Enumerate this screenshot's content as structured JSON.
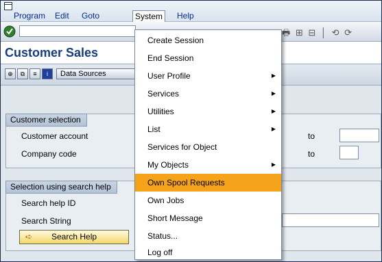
{
  "menubar": {
    "items": [
      "Program",
      "Edit",
      "Goto",
      "System",
      "Help"
    ]
  },
  "title": "Customer Sales",
  "apptoolbar": {
    "data_sources_label": "Data Sources"
  },
  "groups": {
    "customer_selection": {
      "title": "Customer selection",
      "rows": [
        "Customer account",
        "Company code"
      ],
      "to_label": "to"
    },
    "search_help": {
      "title": "Selection using search help",
      "rows": [
        "Search help ID",
        "Search String"
      ],
      "button": "Search Help"
    }
  },
  "system_menu": {
    "items": [
      {
        "label": "Create Session",
        "submenu": false
      },
      {
        "label": "End Session",
        "submenu": false
      },
      {
        "label": "User Profile",
        "submenu": true
      },
      {
        "label": "Services",
        "submenu": true
      },
      {
        "label": "Utilities",
        "submenu": true
      },
      {
        "label": "List",
        "submenu": true
      },
      {
        "label": "Services for Object",
        "submenu": false
      },
      {
        "label": "My Objects",
        "submenu": true
      },
      {
        "label": "Own Spool Requests",
        "submenu": false,
        "highlighted": true
      },
      {
        "label": "Own Jobs",
        "submenu": false
      },
      {
        "label": "Short Message",
        "submenu": false
      },
      {
        "label": "Status...",
        "submenu": false
      },
      {
        "label": "Log off",
        "submenu": false
      }
    ]
  },
  "colors": {
    "highlight": "#f5a31b",
    "title": "#143c7c"
  }
}
